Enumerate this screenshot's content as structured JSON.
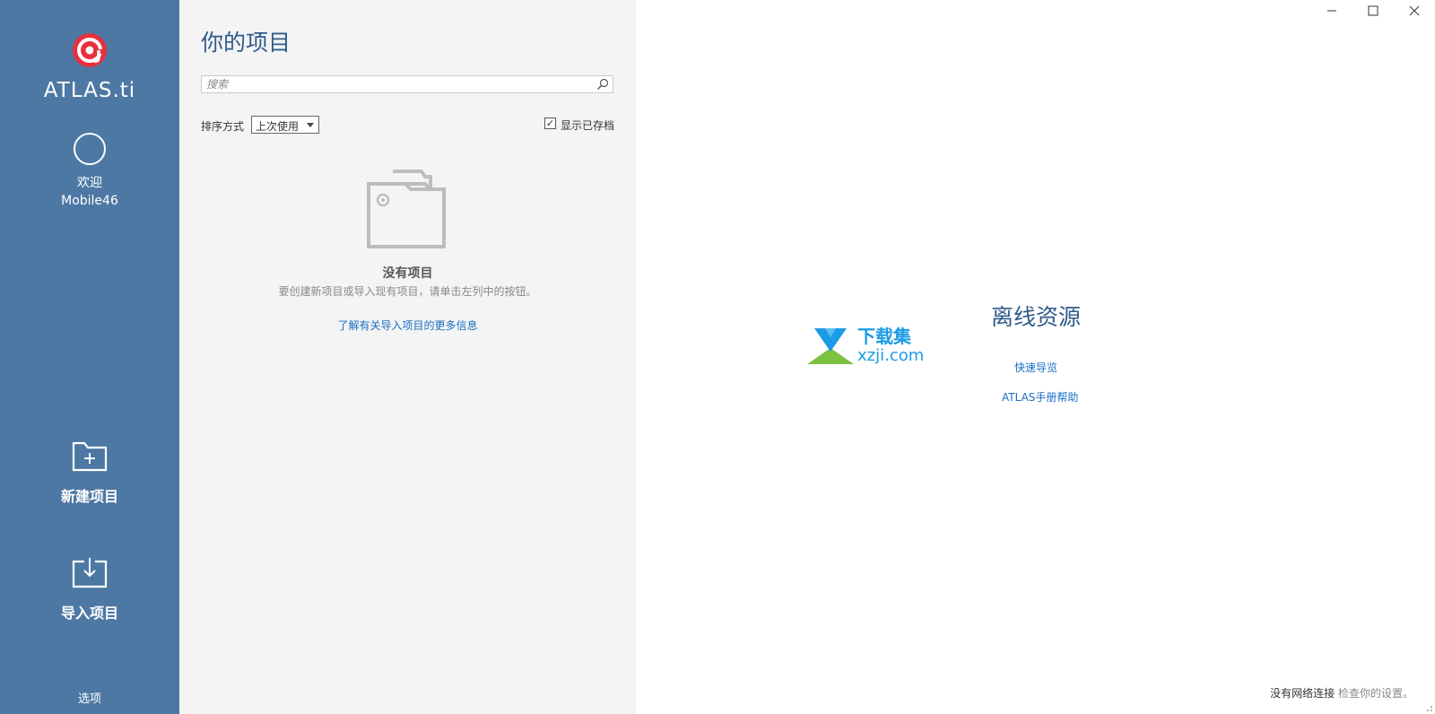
{
  "app": {
    "logo_text": "ATLAS.ti",
    "brand_color": "#e8303c",
    "sidebar_color": "#4e78a4"
  },
  "user": {
    "welcome": "欢迎",
    "name": "Mobile46"
  },
  "sidebar": {
    "new_project": "新建项目",
    "import_project": "导入项目",
    "options": "选项"
  },
  "projects": {
    "title": "你的项目",
    "search_placeholder": "搜索",
    "sort_label": "排序方式",
    "sort_value": "上次使用",
    "show_archived": "显示已存档",
    "show_archived_checked": true,
    "empty_title": "没有项目",
    "empty_desc": "要创建新项目或导入现有项目，请单击左列中的按钮。",
    "learn_more": "了解有关导入项目的更多信息"
  },
  "resources": {
    "title": "离线资源",
    "quick_tour": "快速导览",
    "manual": "ATLAS手册帮助"
  },
  "watermark": {
    "cn": "下载集",
    "url": "xzji.com"
  },
  "status": {
    "no_network": "没有网络连接",
    "check_settings": "检查你的设置。"
  },
  "window_controls": {
    "minimize": "minimize-icon",
    "maximize": "maximize-icon",
    "close": "close-icon"
  }
}
